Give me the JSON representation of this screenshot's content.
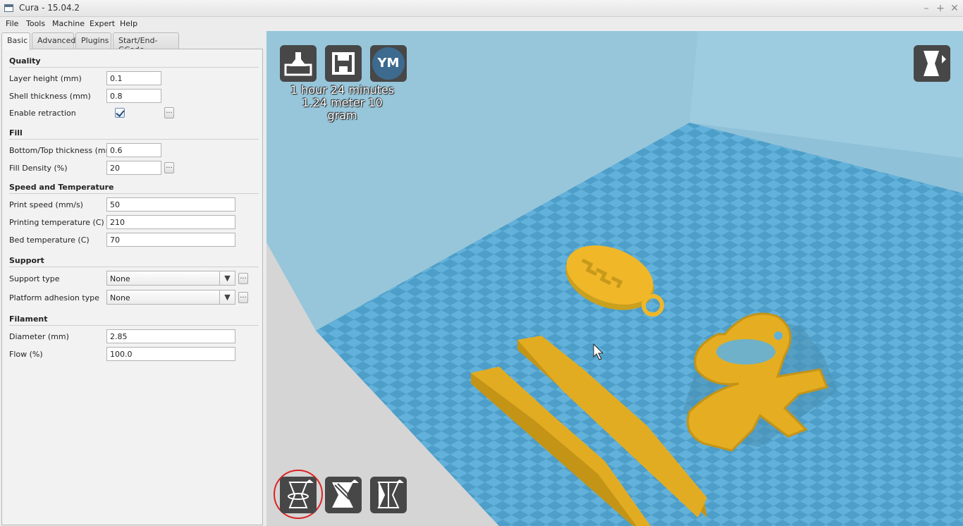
{
  "window": {
    "title": "Cura - 15.04.2"
  },
  "menu": [
    "File",
    "Tools",
    "Machine",
    "Expert",
    "Help"
  ],
  "tabs": [
    "Basic",
    "Advanced",
    "Plugins",
    "Start/End-GCode"
  ],
  "quality": {
    "heading": "Quality",
    "layer_height": {
      "label": "Layer height (mm)",
      "value": "0.1"
    },
    "shell_thickness": {
      "label": "Shell thickness (mm)",
      "value": "0.8"
    },
    "retraction": {
      "label": "Enable retraction",
      "checked": true
    }
  },
  "fill": {
    "heading": "Fill",
    "bottom_top": {
      "label": "Bottom/Top thickness (mm)",
      "value": "0.6"
    },
    "density": {
      "label": "Fill Density (%)",
      "value": "20"
    }
  },
  "speed": {
    "heading": "Speed and Temperature",
    "print_speed": {
      "label": "Print speed (mm/s)",
      "value": "50"
    },
    "print_temp": {
      "label": "Printing temperature (C)",
      "value": "210"
    },
    "bed_temp": {
      "label": "Bed temperature (C)",
      "value": "70"
    }
  },
  "support": {
    "heading": "Support",
    "type": {
      "label": "Support type",
      "value": "None"
    },
    "adhesion": {
      "label": "Platform adhesion type",
      "value": "None"
    }
  },
  "filament": {
    "heading": "Filament",
    "diameter": {
      "label": "Diameter (mm)",
      "value": "2.85"
    },
    "flow": {
      "label": "Flow (%)",
      "value": "100.0"
    }
  },
  "dots_label": "...",
  "viewport": {
    "print_time": "1 hour 24 minutes",
    "material": "1.24 meter 10 gram",
    "ym_label": "YM"
  },
  "colors": {
    "viewport_bg": "#8fc1d8",
    "model": "#f0b729",
    "button_bg": "#474747",
    "highlight_circle": "#dd2222"
  }
}
